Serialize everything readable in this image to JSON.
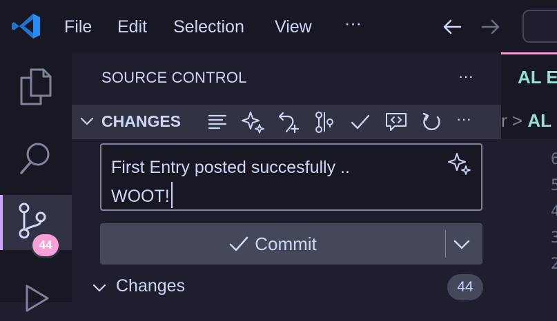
{
  "titlebar": {
    "menu": [
      "File",
      "Edit",
      "Selection",
      "View"
    ],
    "more": "···"
  },
  "activitybar": {
    "items": [
      {
        "name": "explorer",
        "icon": "files-icon"
      },
      {
        "name": "search",
        "icon": "search-icon"
      },
      {
        "name": "source-control",
        "icon": "source-control-icon",
        "badge": "44"
      },
      {
        "name": "run-debug",
        "icon": "run-icon"
      }
    ]
  },
  "sidebar": {
    "title": "SOURCE CONTROL",
    "more": "···",
    "section": {
      "title": "CHANGES",
      "tools": [
        "list-view-icon",
        "sparkle-icon",
        "undo-plus-icon",
        "compare-icon",
        "check-icon",
        "comment-icon",
        "refresh-icon",
        "more-icon"
      ],
      "more": "···"
    },
    "commit_message": {
      "line1": "First Entry posted succesfully ..",
      "line2": "WOOT!"
    },
    "commit_button": {
      "label": "Commit"
    },
    "changes": {
      "label": "Changes",
      "count": "44"
    }
  },
  "editor": {
    "tab_text": "AL E",
    "breadcrumb_prefix": "r",
    "breadcrumb_sep": ">",
    "breadcrumb_al": "AL",
    "line_numbers": [
      "6",
      "5",
      "4",
      "3",
      "2"
    ]
  },
  "colors": {
    "accent_purple": "#cba6f7",
    "badge_pink": "#f5a0d6",
    "teal": "#94e2d5",
    "vscode_blue": "#2a8cf0"
  }
}
